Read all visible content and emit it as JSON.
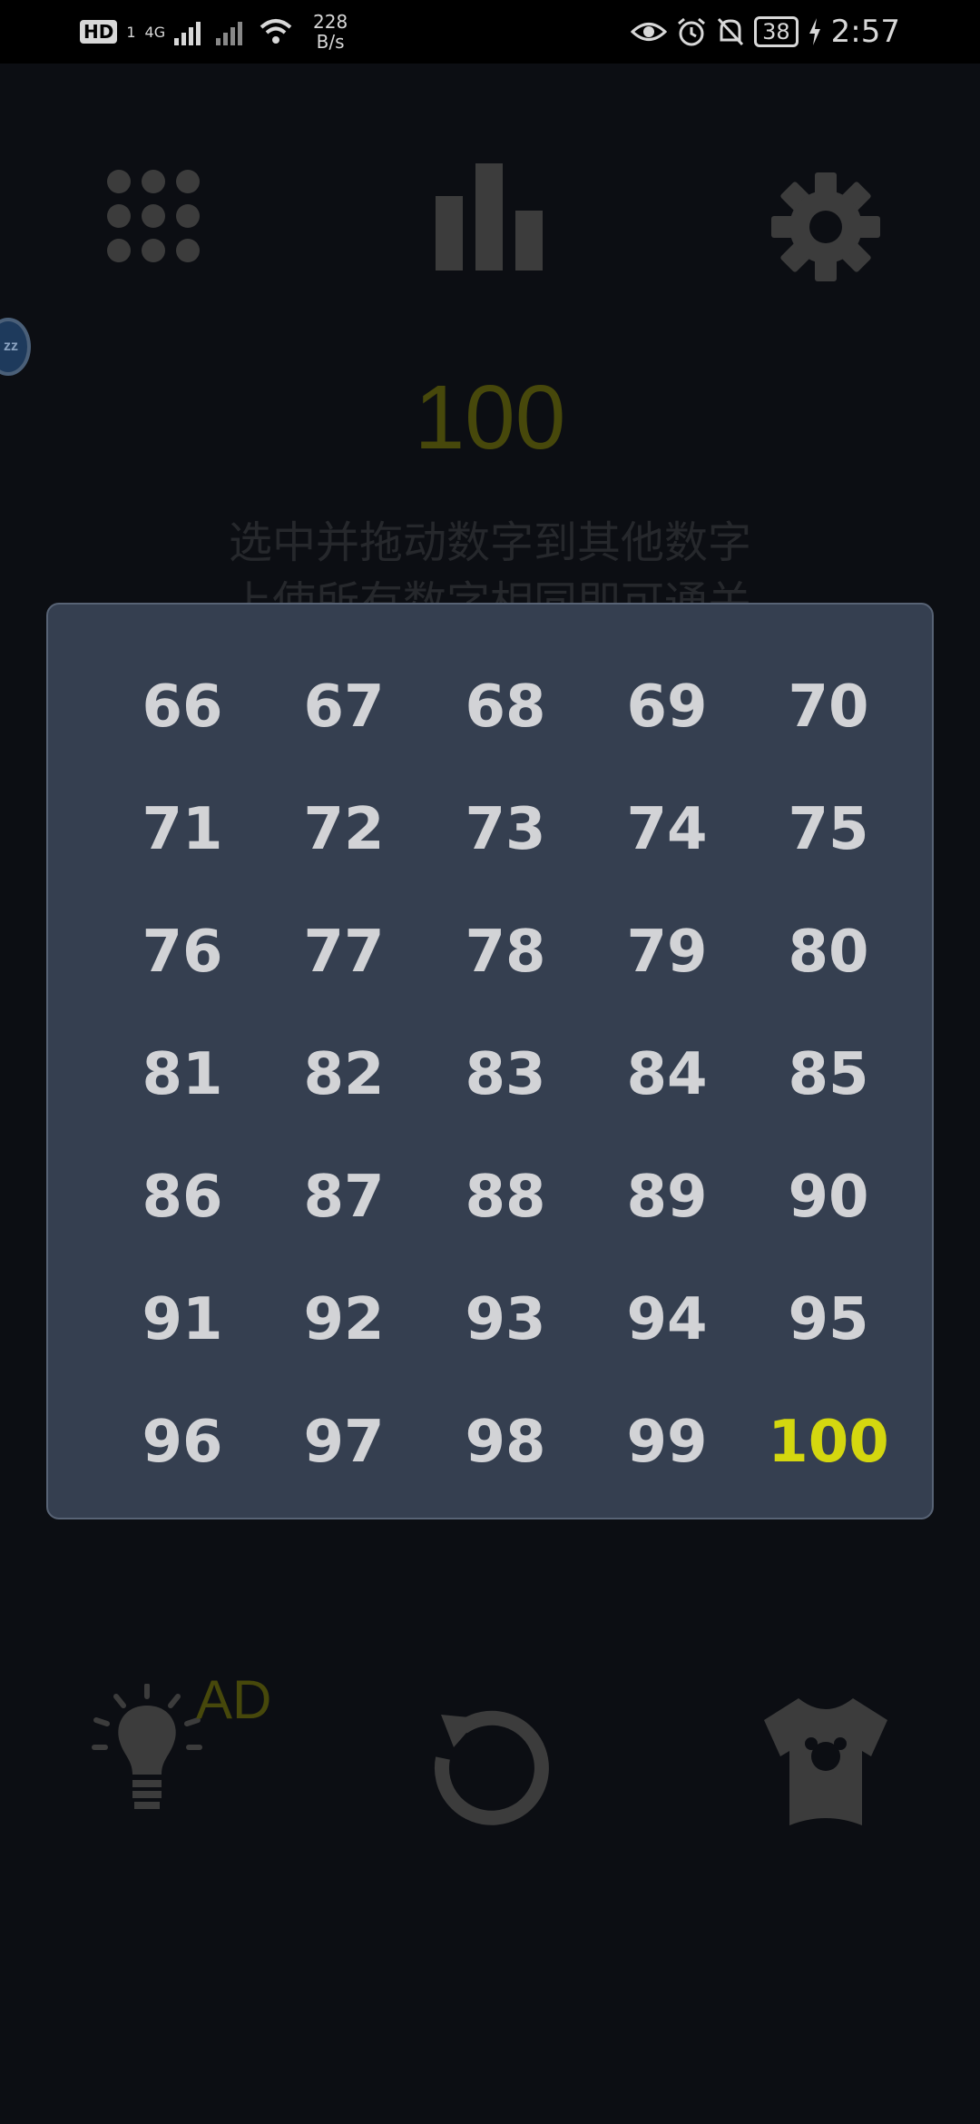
{
  "status_bar": {
    "hd_badge": "HD",
    "hd_sub": "1",
    "network_type": "4G",
    "speed_value": "228",
    "speed_unit": "B/s",
    "battery": "38",
    "time": "2:57",
    "icons": [
      "eye-icon",
      "alarm-icon",
      "mute-icon",
      "battery-icon",
      "charging-icon",
      "wifi-icon",
      "signal-icon"
    ]
  },
  "game": {
    "score": "100",
    "instruction_line1": "选中并拖动数字到其他数字",
    "instruction_line2": "上使所有数字相同即可通关",
    "top_buttons": [
      "levels-grid-icon",
      "leaderboard-icon",
      "settings-gear-icon"
    ],
    "bottom_buttons": [
      "hint-bulb-icon",
      "restart-icon",
      "skin-shirt-icon"
    ],
    "ad_label": "AD",
    "bubble_label": "zz"
  },
  "level_panel": {
    "current_level": "100",
    "levels": [
      "66",
      "67",
      "68",
      "69",
      "70",
      "71",
      "72",
      "73",
      "74",
      "75",
      "76",
      "77",
      "78",
      "79",
      "80",
      "81",
      "82",
      "83",
      "84",
      "85",
      "86",
      "87",
      "88",
      "89",
      "90",
      "91",
      "92",
      "93",
      "94",
      "95",
      "96",
      "97",
      "98",
      "99",
      "100"
    ]
  },
  "colors": {
    "panel_bg": "#353f50",
    "level_text": "#d2d3d6",
    "current_level_text": "#d4d70f",
    "score_text": "#47480b",
    "icon_dim": "#3c3c3c"
  }
}
